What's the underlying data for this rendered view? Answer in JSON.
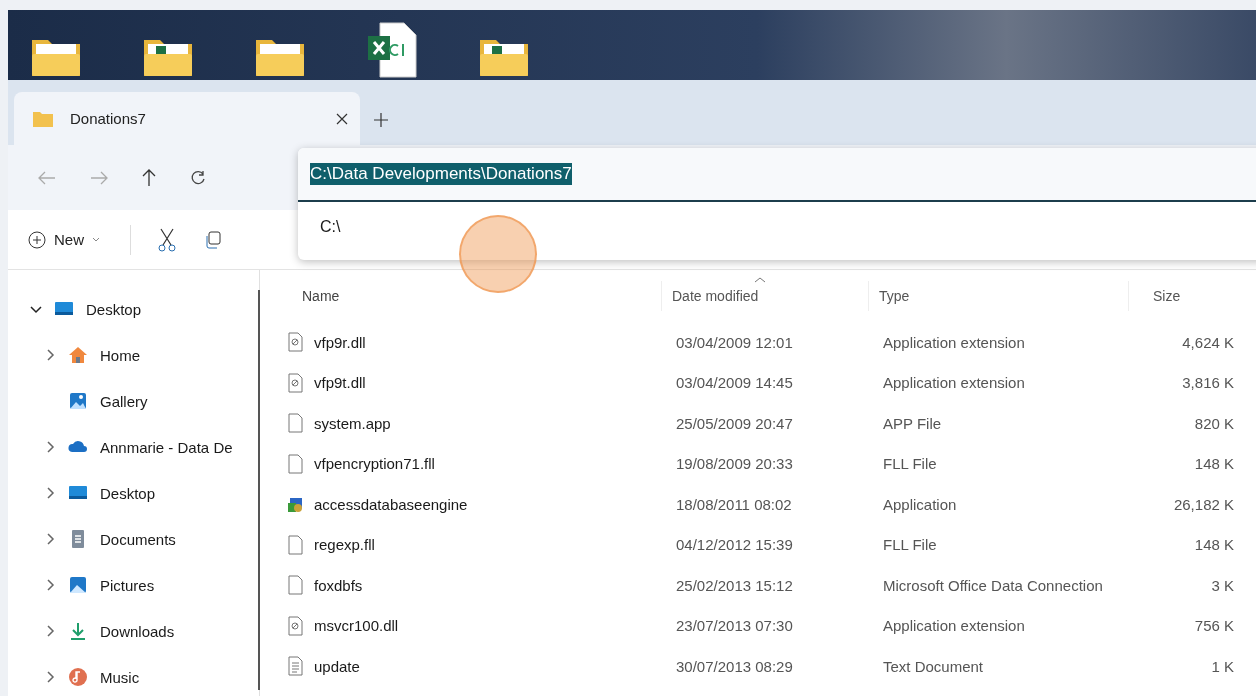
{
  "desktop_icons": [
    {
      "kind": "folder"
    },
    {
      "kind": "folder-excel"
    },
    {
      "kind": "folder"
    },
    {
      "kind": "excel-file"
    },
    {
      "kind": "folder-excel"
    }
  ],
  "tabs": [
    {
      "label": "Donations7",
      "selected": true
    }
  ],
  "address_bar": {
    "value": "C:\\Data Developments\\Donations7",
    "suggestions": [
      "C:\\"
    ]
  },
  "command_bar": {
    "new_label": "New"
  },
  "sidebar": {
    "items": [
      {
        "label": "Desktop",
        "kind": "desktop",
        "expanded": true,
        "children": [
          {
            "label": "Home",
            "kind": "home",
            "expanded": false
          },
          {
            "label": "Gallery",
            "kind": "gallery"
          },
          {
            "label": "Annmarie - Data De",
            "kind": "cloud",
            "expanded": false
          },
          {
            "label": "Desktop",
            "kind": "desktop",
            "expanded": false
          },
          {
            "label": "Documents",
            "kind": "documents",
            "expanded": false
          },
          {
            "label": "Pictures",
            "kind": "pictures",
            "expanded": false
          },
          {
            "label": "Downloads",
            "kind": "downloads",
            "expanded": false
          },
          {
            "label": "Music",
            "kind": "music",
            "expanded": false
          }
        ]
      }
    ]
  },
  "table": {
    "columns": [
      {
        "label": "Name",
        "sorted": false
      },
      {
        "label": "Date modified",
        "sorted": true
      },
      {
        "label": "Type",
        "sorted": false
      },
      {
        "label": "Size",
        "sorted": false
      }
    ],
    "rows": [
      {
        "kind": "dll",
        "name": "vfp9r.dll",
        "date": "03/04/2009 12:01",
        "type": "Application extension",
        "size": "4,624 K"
      },
      {
        "kind": "dll",
        "name": "vfp9t.dll",
        "date": "03/04/2009 14:45",
        "type": "Application extension",
        "size": "3,816 K"
      },
      {
        "kind": "file",
        "name": "system.app",
        "date": "25/05/2009 20:47",
        "type": "APP File",
        "size": "820 K"
      },
      {
        "kind": "file",
        "name": "vfpencryption71.fll",
        "date": "19/08/2009 20:33",
        "type": "FLL File",
        "size": "148 K"
      },
      {
        "kind": "setup",
        "name": "accessdatabaseengine",
        "date": "18/08/2011 08:02",
        "type": "Application",
        "size": "26,182 K"
      },
      {
        "kind": "file",
        "name": "regexp.fll",
        "date": "04/12/2012 15:39",
        "type": "FLL File",
        "size": "148 K"
      },
      {
        "kind": "file",
        "name": "foxdbfs",
        "date": "25/02/2013 15:12",
        "type": "Microsoft Office Data Connection",
        "size": "3 K"
      },
      {
        "kind": "dll",
        "name": "msvcr100.dll",
        "date": "23/07/2013 07:30",
        "type": "Application extension",
        "size": "756 K"
      },
      {
        "kind": "text",
        "name": "update",
        "date": "30/07/2013 08:29",
        "type": "Text Document",
        "size": "1 K"
      }
    ]
  }
}
